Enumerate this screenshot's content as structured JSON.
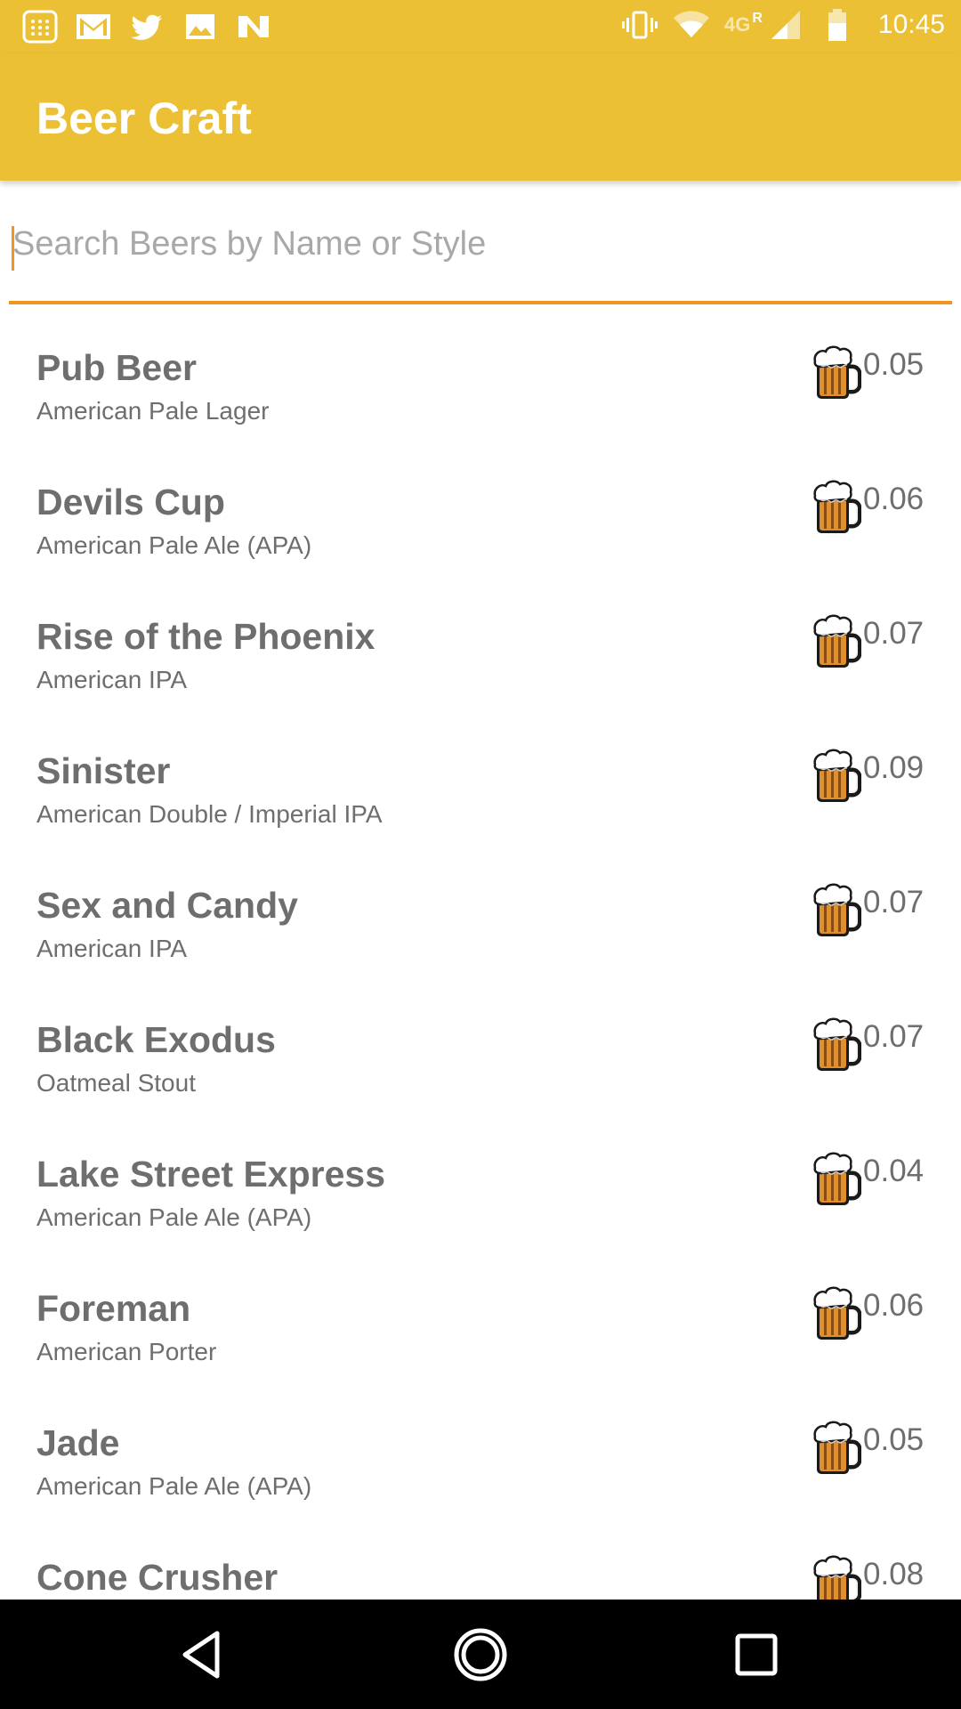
{
  "status_bar": {
    "time": "10:45",
    "network": "4G",
    "roaming": "R",
    "left_icons": [
      "calculator-icon",
      "gmail-icon",
      "twitter-icon",
      "photo-icon",
      "n-app-icon"
    ],
    "right_icons": [
      "vibrate-icon",
      "wifi-icon",
      "signal-icon",
      "battery-icon"
    ]
  },
  "app_bar": {
    "title": "Beer Craft",
    "color": "#EBC034"
  },
  "search": {
    "placeholder": "Search Beers by Name or Style",
    "value": "",
    "underline_color": "#F0961E"
  },
  "beers": [
    {
      "name": "Pub Beer",
      "style": "American Pale Lager",
      "abv": "0.05"
    },
    {
      "name": "Devils Cup",
      "style": "American Pale Ale (APA)",
      "abv": "0.06"
    },
    {
      "name": "Rise of the Phoenix",
      "style": "American IPA",
      "abv": "0.07"
    },
    {
      "name": "Sinister",
      "style": "American Double / Imperial IPA",
      "abv": "0.09"
    },
    {
      "name": "Sex and Candy",
      "style": "American IPA",
      "abv": "0.07"
    },
    {
      "name": "Black Exodus",
      "style": "Oatmeal Stout",
      "abv": "0.07"
    },
    {
      "name": "Lake Street Express",
      "style": "American Pale Ale (APA)",
      "abv": "0.04"
    },
    {
      "name": "Foreman",
      "style": "American Porter",
      "abv": "0.06"
    },
    {
      "name": "Jade",
      "style": "American Pale Ale (APA)",
      "abv": "0.05"
    },
    {
      "name": "Cone Crusher",
      "style": "",
      "abv": "0.08"
    }
  ],
  "nav_bar": {
    "buttons": [
      "back-icon",
      "home-icon",
      "recents-icon"
    ]
  }
}
